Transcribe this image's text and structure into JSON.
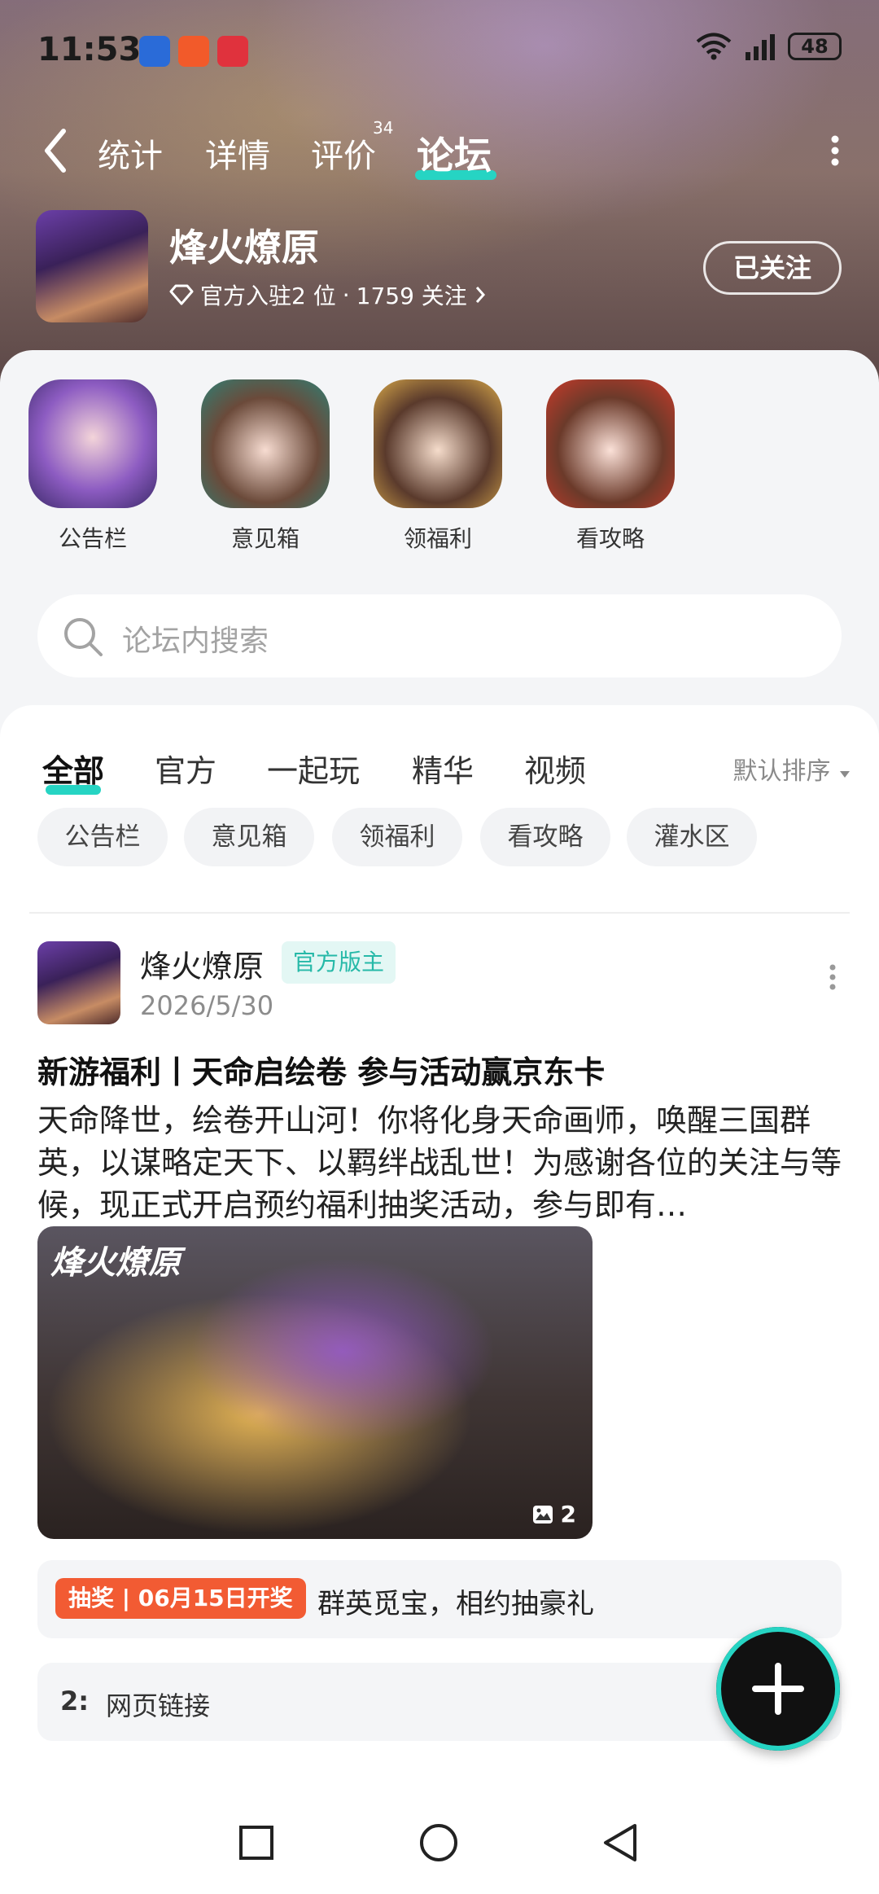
{
  "status_bar": {
    "time": "11:53",
    "battery": "48"
  },
  "nav": {
    "tabs": [
      {
        "label": "统计"
      },
      {
        "label": "详情"
      },
      {
        "label": "评价",
        "badge": "34"
      },
      {
        "label": "论坛",
        "active": true
      }
    ]
  },
  "forum": {
    "title": "烽火燎原",
    "official_text": "官方入驻2 位",
    "separator": "·",
    "followers": "1759 关注",
    "follow_button": "已关注"
  },
  "shortcuts": [
    {
      "label": "公告栏"
    },
    {
      "label": "意见箱"
    },
    {
      "label": "领福利"
    },
    {
      "label": "看攻略"
    }
  ],
  "search": {
    "placeholder": "论坛内搜索"
  },
  "filter_tabs": [
    "全部",
    "官方",
    "一起玩",
    "精华",
    "视频"
  ],
  "sort_label": "默认排序",
  "chips": [
    "公告栏",
    "意见箱",
    "领福利",
    "看攻略",
    "灌水区"
  ],
  "post": {
    "author": "烽火燎原",
    "badge": "官方版主",
    "date": "2026/5/30",
    "title": "新游福利丨天命启绘卷 参与活动赢京东卡",
    "body": "天命降世，绘卷开山河！你将化身天命画师，唤醒三国群英，以谋略定天下、以羁绊战乱世！为感谢各位的关注与等候，现正式开启预约福利抽奖活动，参与即有…",
    "image_logo": "烽火燎原",
    "image_count": "2",
    "lottery_tag": "抽奖 | 06月15日开奖",
    "lottery_text": "群英觅宝，相约抽豪礼",
    "link_index": "2:",
    "link_text": "网页链接"
  },
  "colors": {
    "accent": "#26d4c3",
    "lottery": "#f25b33",
    "badge_text": "#26b9a8"
  }
}
